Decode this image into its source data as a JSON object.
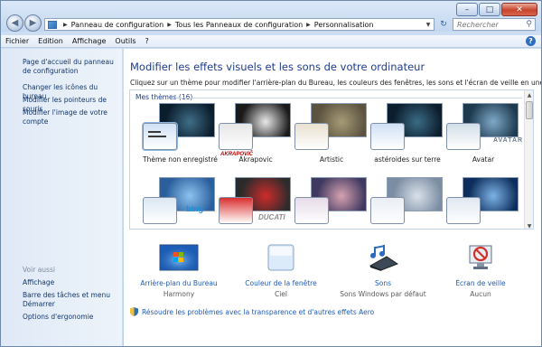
{
  "address": {
    "crumbs": [
      "Panneau de configuration",
      "Tous les Panneaux de configuration",
      "Personnalisation"
    ]
  },
  "search": {
    "placeholder": "Rechercher"
  },
  "menu": {
    "items": [
      "Fichier",
      "Edition",
      "Affichage",
      "Outils",
      "?"
    ]
  },
  "sidebar": {
    "home": "Page d'accueil du panneau de configuration",
    "links": [
      "Changer les icônes du bureau",
      "Modifier les pointeurs de souris",
      "Modifier l'image de votre compte"
    ],
    "see_also_title": "Voir aussi",
    "see_also": [
      "Affichage",
      "Barre des tâches et menu Démarrer",
      "Options d'ergonomie"
    ]
  },
  "main": {
    "title": "Modifier les effets visuels et les sons de votre ordinateur",
    "intro": "Cliquez sur un thème pour modifier l'arrière-plan du Bureau, les couleurs des fenêtres, les sons et l'écran de veille en une seule fois.",
    "section_title": "Mes thèmes (16)",
    "themes": [
      {
        "name": "Thème non enregistré",
        "bg": "#0b1c2c",
        "accent": "#3f6e86",
        "chip": "#cfe0f4",
        "selected": true
      },
      {
        "name": "Akrapovic",
        "bg": "#1a1a1a",
        "accent": "#e9e9e9",
        "chip": "#e6e6e6",
        "brand": "AKRAPOVIČ"
      },
      {
        "name": "Artistic",
        "bg": "#5b5240",
        "accent": "#a79b76",
        "chip": "#e9e0cf"
      },
      {
        "name": "astéroides sur terre",
        "bg": "#0c1d2d",
        "accent": "#3a6b84",
        "chip": "#cfe0f4"
      },
      {
        "name": "Avatar",
        "bg": "#1d3a4f",
        "accent": "#7fa9c8",
        "chip": "#d2dee8",
        "brand": "AVATAR"
      },
      {
        "name": "",
        "bg": "#2a5e9c",
        "accent": "#8cc3ef",
        "chip": "#dbe7f3",
        "brand": "bing"
      },
      {
        "name": "",
        "bg": "#2b2b2b",
        "accent": "#cf2b2b",
        "chip": "#d9302f",
        "brand": "DUCATI"
      },
      {
        "name": "",
        "bg": "#3f3860",
        "accent": "#d6a2b0",
        "chip": "#e6dbe8"
      },
      {
        "name": "",
        "bg": "#7b8da3",
        "accent": "#d9e1ea",
        "chip": "#e9eef4"
      },
      {
        "name": "",
        "bg": "#0d2e5c",
        "accent": "#7db3e6",
        "chip": "#dfe7f0"
      }
    ]
  },
  "bottom": [
    {
      "label": "Arrière-plan du Bureau",
      "value": "Harmony",
      "icon": "desktop-background-icon"
    },
    {
      "label": "Couleur de la fenêtre",
      "value": "Ciel",
      "icon": "window-color-icon"
    },
    {
      "label": "Sons",
      "value": "Sons Windows par défaut",
      "icon": "sounds-icon"
    },
    {
      "label": "Écran de veille",
      "value": "Aucun",
      "icon": "screensaver-icon"
    }
  ],
  "troubleshoot_link": "Résoudre les problèmes avec la transparence et d'autres effets Aero",
  "colors": {
    "link": "#1f5bb5",
    "title": "#1e3d8f",
    "sidebar": "#dfe9f6"
  }
}
